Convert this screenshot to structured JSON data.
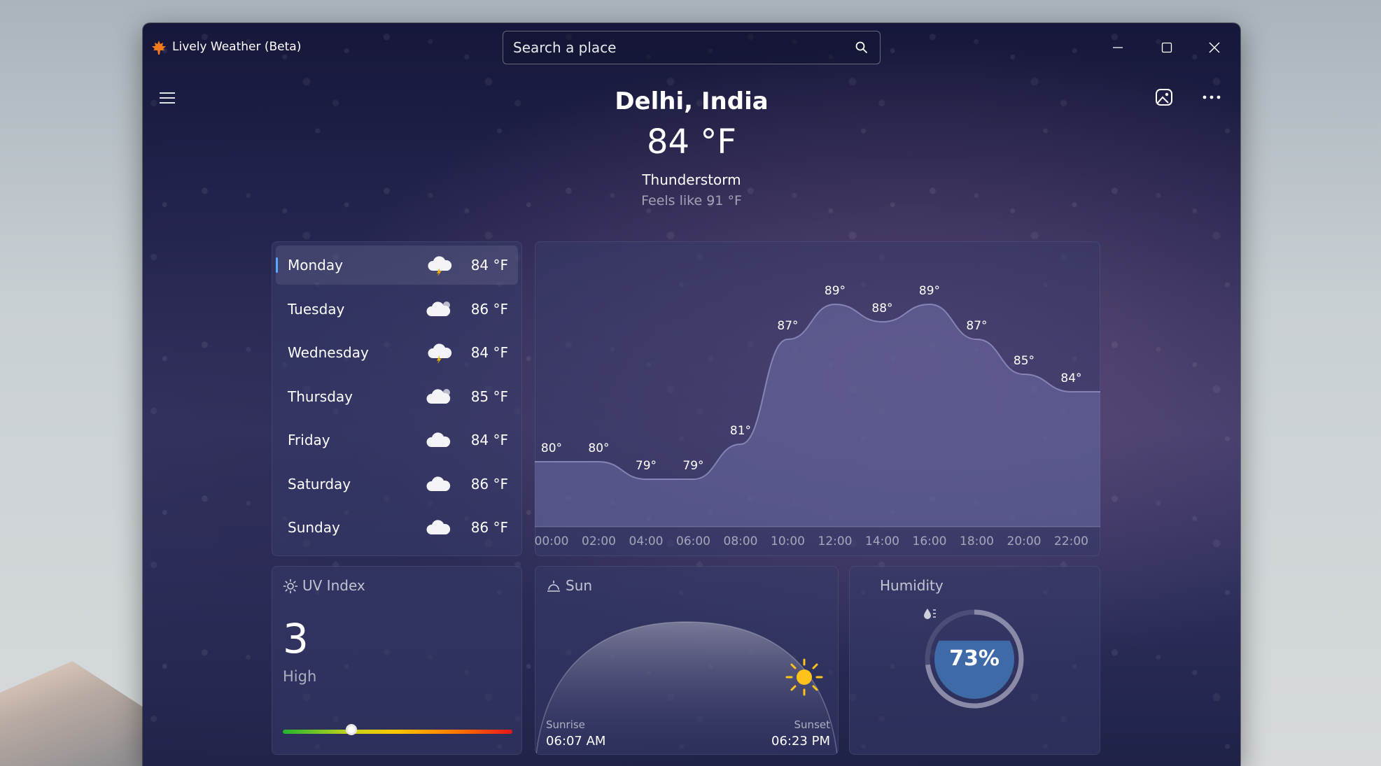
{
  "app": {
    "title": "Lively Weather (Beta)"
  },
  "search": {
    "placeholder": "Search a place"
  },
  "current": {
    "location": "Delhi, India",
    "temperature": "84 °F",
    "condition": "Thunderstorm",
    "feels_like": "Feels like 91 °F"
  },
  "forecast": [
    {
      "day": "Monday",
      "temp": "84 °F",
      "icon": "thunderstorm-icon",
      "selected": true
    },
    {
      "day": "Tuesday",
      "temp": "86 °F",
      "icon": "partly-cloudy-night-icon",
      "selected": false
    },
    {
      "day": "Wednesday",
      "temp": "84 °F",
      "icon": "thunderstorm-icon",
      "selected": false
    },
    {
      "day": "Thursday",
      "temp": "85 °F",
      "icon": "partly-cloudy-night-icon",
      "selected": false
    },
    {
      "day": "Friday",
      "temp": "84 °F",
      "icon": "cloud-icon",
      "selected": false
    },
    {
      "day": "Saturday",
      "temp": "86 °F",
      "icon": "cloud-icon",
      "selected": false
    },
    {
      "day": "Sunday",
      "temp": "86 °F",
      "icon": "cloud-icon",
      "selected": false
    }
  ],
  "chart_data": {
    "type": "area",
    "x": [
      "00:00",
      "02:00",
      "04:00",
      "06:00",
      "08:00",
      "10:00",
      "12:00",
      "14:00",
      "16:00",
      "18:00",
      "20:00",
      "22:00"
    ],
    "values": [
      80,
      80,
      79,
      79,
      81,
      87,
      89,
      88,
      89,
      87,
      85,
      84
    ],
    "value_labels": [
      "80°",
      "80°",
      "79°",
      "79°",
      "81°",
      "87°",
      "89°",
      "88°",
      "89°",
      "87°",
      "85°",
      "84°"
    ],
    "grid": false
  },
  "uv": {
    "title": "UV Index",
    "value": "3",
    "level": "High",
    "fraction": 0.3
  },
  "sun": {
    "title": "Sun",
    "sunrise_label": "Sunrise",
    "sunrise_time": "06:07 AM",
    "sunset_label": "Sunset",
    "sunset_time": "06:23 PM"
  },
  "humidity": {
    "title": "Humidity",
    "value": "73%",
    "fraction": 0.73
  },
  "colors": {
    "accent": "#5aa8ff",
    "sun": "#ffc21a",
    "humidity_fill": "#3e6aa8"
  }
}
